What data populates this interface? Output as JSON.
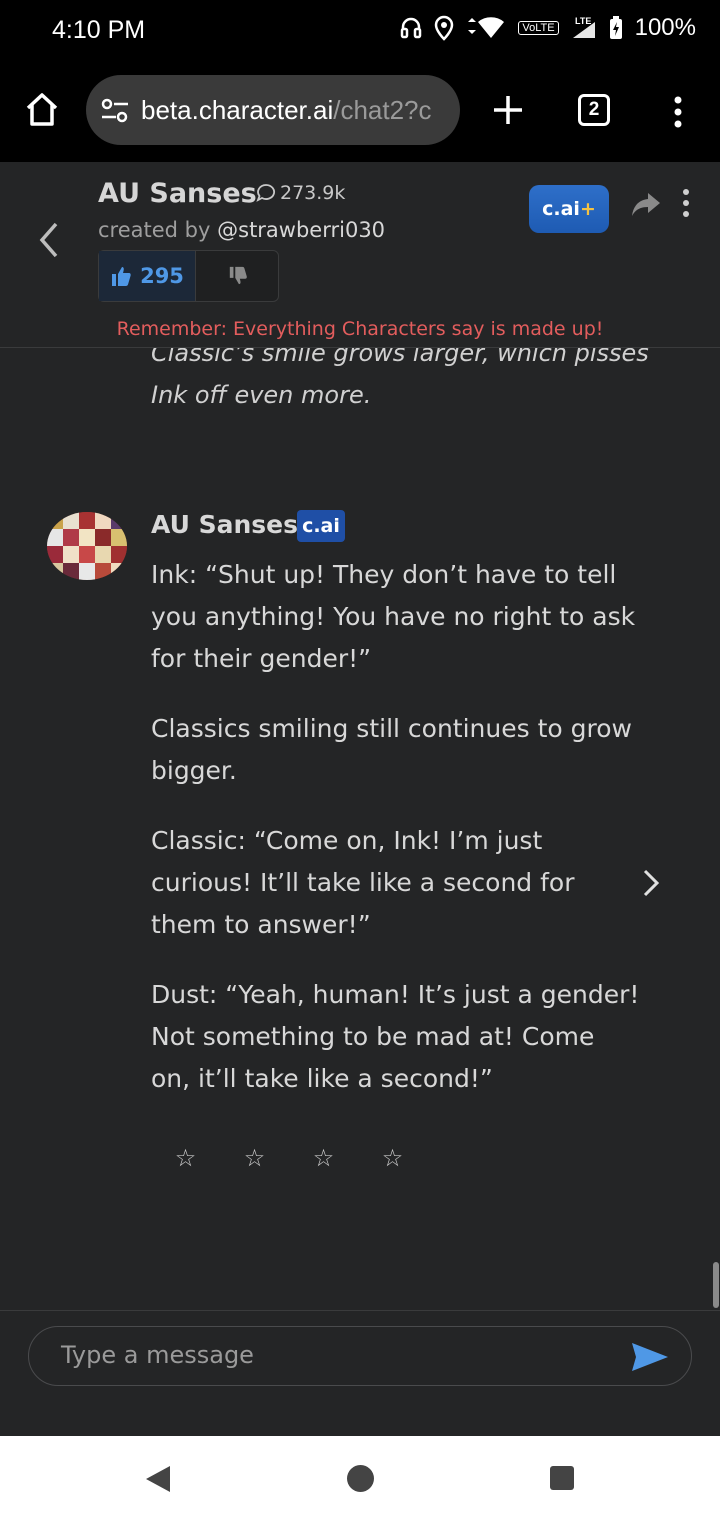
{
  "status_bar": {
    "time": "4:10 PM",
    "network_badge": "VoLTE",
    "lte_label": "LTE",
    "battery": "100%"
  },
  "browser": {
    "url_host": "beta.character.ai",
    "url_path": "/chat2?c",
    "tab_count": "2"
  },
  "character": {
    "name": "AU Sanses",
    "chat_count": "273.9k",
    "created_by_label": "created by",
    "creator": "@strawberri030",
    "upvotes": "295",
    "plus_label": "c.ai",
    "plus_suffix": "+"
  },
  "disclaimer": "Remember: Everything Characters say is made up!",
  "previous_message": "Classic’s smile grows larger, which pisses Ink off even more.",
  "message": {
    "author": "AU Sanses",
    "badge": "c.ai",
    "paragraphs": [
      "Ink: “Shut up! They don’t have to tell you anything! You have no right to ask for their gender!”",
      "Classics smiling still continues to grow bigger.",
      "Classic: “Come on, Ink! I’m just curious! It’ll take like a second for them to answer!”",
      "Dust: “Yeah, human! It’s just a gender! Not something to be mad at! Come on, it’ll take like a second!”"
    ],
    "rating_stars": 4,
    "star_glyph": "☆",
    "rating_value": 0
  },
  "composer": {
    "placeholder": "Type a message"
  },
  "colors": {
    "background": "#242526",
    "accent_blue": "#4f98e6",
    "disclaimer_red": "#e35d5d",
    "badge_blue": "#1f4fa6"
  },
  "icons": [
    "home-icon",
    "tune-icon",
    "plus-icon",
    "tabs-icon",
    "more-vert-icon",
    "back-chevron-icon",
    "chat-bubble-icon",
    "thumbs-up-icon",
    "thumbs-down-icon",
    "share-icon",
    "chevron-right-icon",
    "star-icon",
    "send-icon",
    "nav-back-icon",
    "nav-home-icon",
    "nav-recents-icon"
  ]
}
